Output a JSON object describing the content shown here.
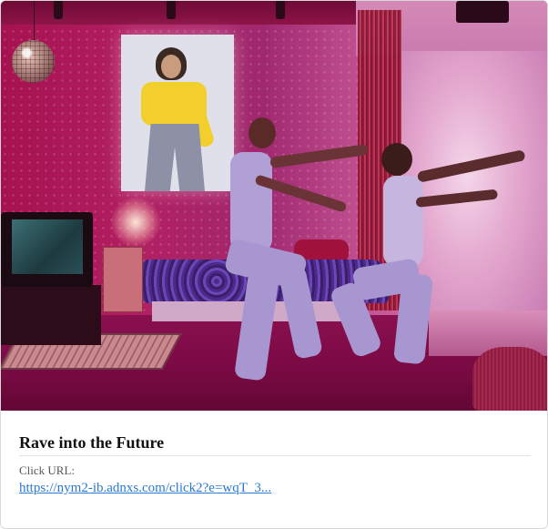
{
  "ad": {
    "title": "Rave into the Future",
    "click_url_label": "Click URL:",
    "click_url": "https://nym2-ib.adnxs.com/click2?e=wqT_3..."
  },
  "colors": {
    "link": "#2a7ad1",
    "title": "#111111",
    "label": "#555555",
    "divider": "#e3e3e3"
  }
}
